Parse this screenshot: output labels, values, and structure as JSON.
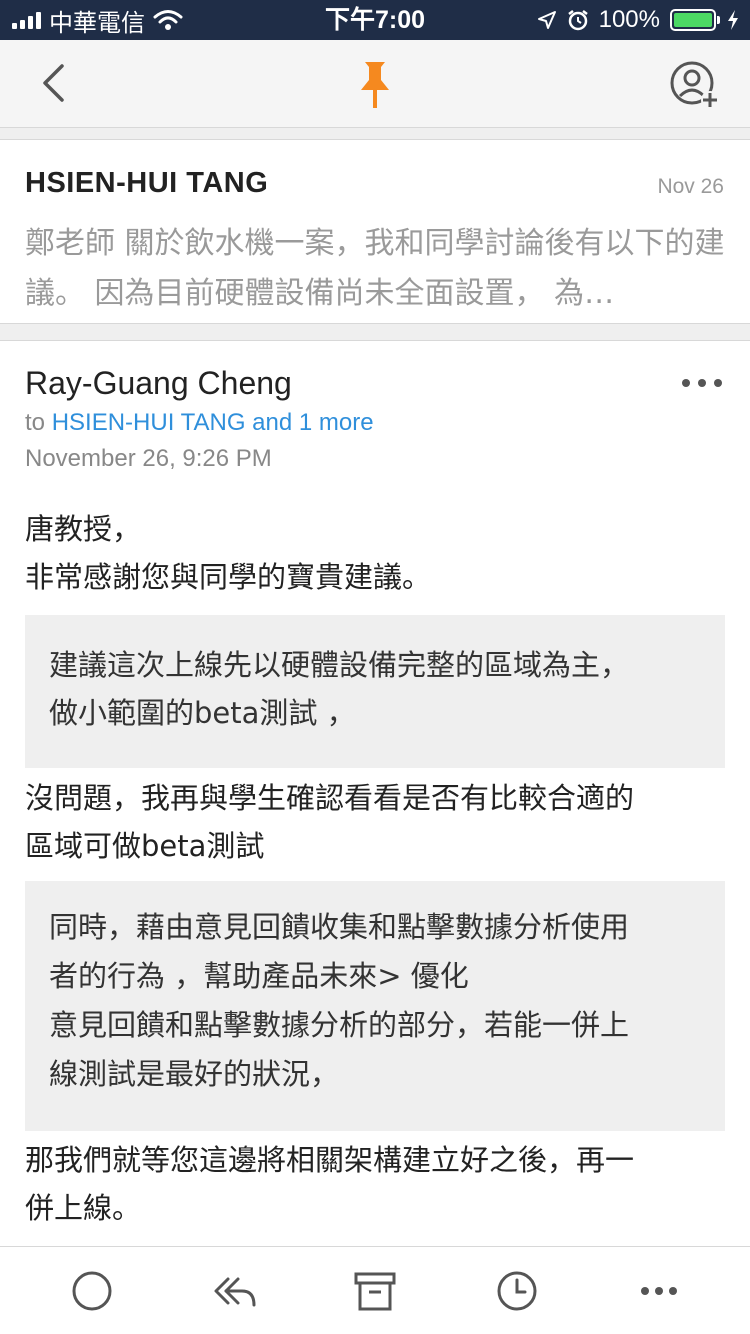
{
  "status_bar": {
    "carrier": "中華電信",
    "time": "下午7:00",
    "battery_percent": "100%"
  },
  "nav": {
    "back_icon": "chevron-left-icon",
    "pin_icon": "pin-icon",
    "pin_color": "#f5891f",
    "contact_icon": "add-contact-icon"
  },
  "collapsed_message": {
    "sender": "HSIEN-HUI TANG",
    "date": "Nov 26",
    "preview": "鄭老師 關於飲水機一案，我和同學討論後有以下的建議。 因為目前硬體設備尚未全面設置， 為…"
  },
  "message": {
    "sender": "Ray-Guang Cheng",
    "to_prefix": "to",
    "recipients": "HSIEN-HUI TANG and 1 more",
    "date": "November 26, 9:26 PM",
    "greeting_line1": "唐教授，",
    "greeting_line2": "非常感謝您與同學的寶貴建議。",
    "quote1_line1": "建議這次上線先以硬體設備完整的區域為主，",
    "quote1_line2": "做小範圍的beta測試 ，",
    "reply1_line1": "沒問題，我再與學生確認看看是否有比較合適的",
    "reply1_line2": "區域可做beta測試",
    "quote2_line1": "同時，藉由意見回饋收集和點擊數據分析使用",
    "quote2_line2": "者的行為 ，幫助產品未來> 優化",
    "quote2_line3": "意見回饋和點擊數據分析的部分，若能一併上",
    "quote2_line4": "線測試是最好的狀況，",
    "reply2_line1": "那我們就等您這邊將相關架構建立好之後，再一",
    "reply2_line2": "併上線。"
  },
  "toolbar": {
    "items": [
      "done-circle-icon",
      "reply-all-icon",
      "archive-icon",
      "schedule-clock-icon",
      "more-icon"
    ]
  },
  "colors": {
    "status_bar_bg": "#1f2d47",
    "link_blue": "#2f8fdb",
    "quote_bg": "#efefef",
    "icon_gray": "#555555"
  }
}
